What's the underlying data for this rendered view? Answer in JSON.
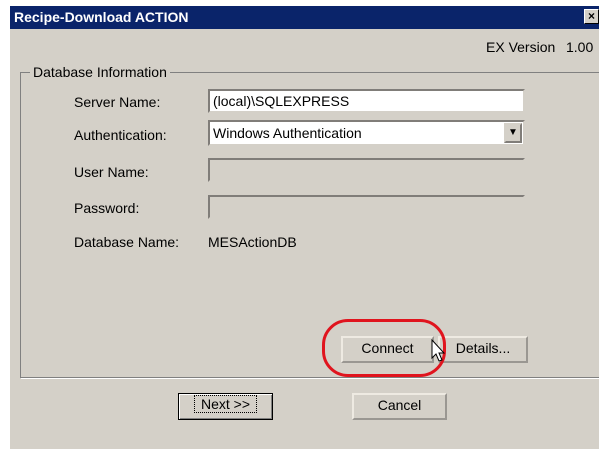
{
  "window": {
    "title": "Recipe-Download ACTION",
    "close_label": "×"
  },
  "version": {
    "label": "EX Version",
    "value": "1.00"
  },
  "group": {
    "title": "Database Information",
    "server_label": "Server Name:",
    "server_value": "(local)\\SQLEXPRESS",
    "auth_label": "Authentication:",
    "auth_value": "Windows Authentication",
    "user_label": "User Name:",
    "user_value": "",
    "password_label": "Password:",
    "password_value": "",
    "dbname_label": "Database Name:",
    "dbname_value": "MESActionDB",
    "connect_label": "Connect",
    "details_label": "Details..."
  },
  "footer": {
    "next_label": "Next >>",
    "cancel_label": "Cancel"
  },
  "colors": {
    "titlebar": "#0a246a",
    "face": "#d4d0c8",
    "highlight": "#e0141e"
  }
}
